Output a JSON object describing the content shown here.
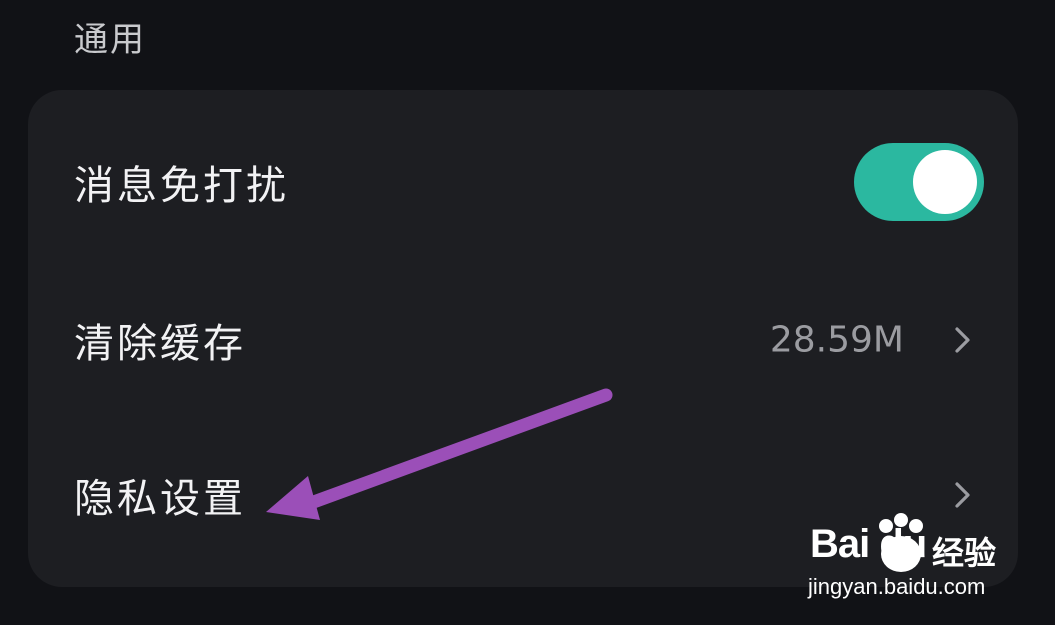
{
  "section": {
    "title": "通用"
  },
  "settings": {
    "rows": [
      {
        "label": "消息免打扰",
        "toggle_on": true
      },
      {
        "label": "清除缓存",
        "value": "28.59M"
      },
      {
        "label": "隐私设置"
      }
    ]
  },
  "annotation": {
    "arrow_color": "#9b4fb8"
  },
  "watermark": {
    "brand": "Bai du",
    "product": "经验",
    "url": "jingyan.baidu.com"
  },
  "colors": {
    "background": "#111216",
    "card": "#1d1e22",
    "toggle_on": "#2bb8a0"
  }
}
